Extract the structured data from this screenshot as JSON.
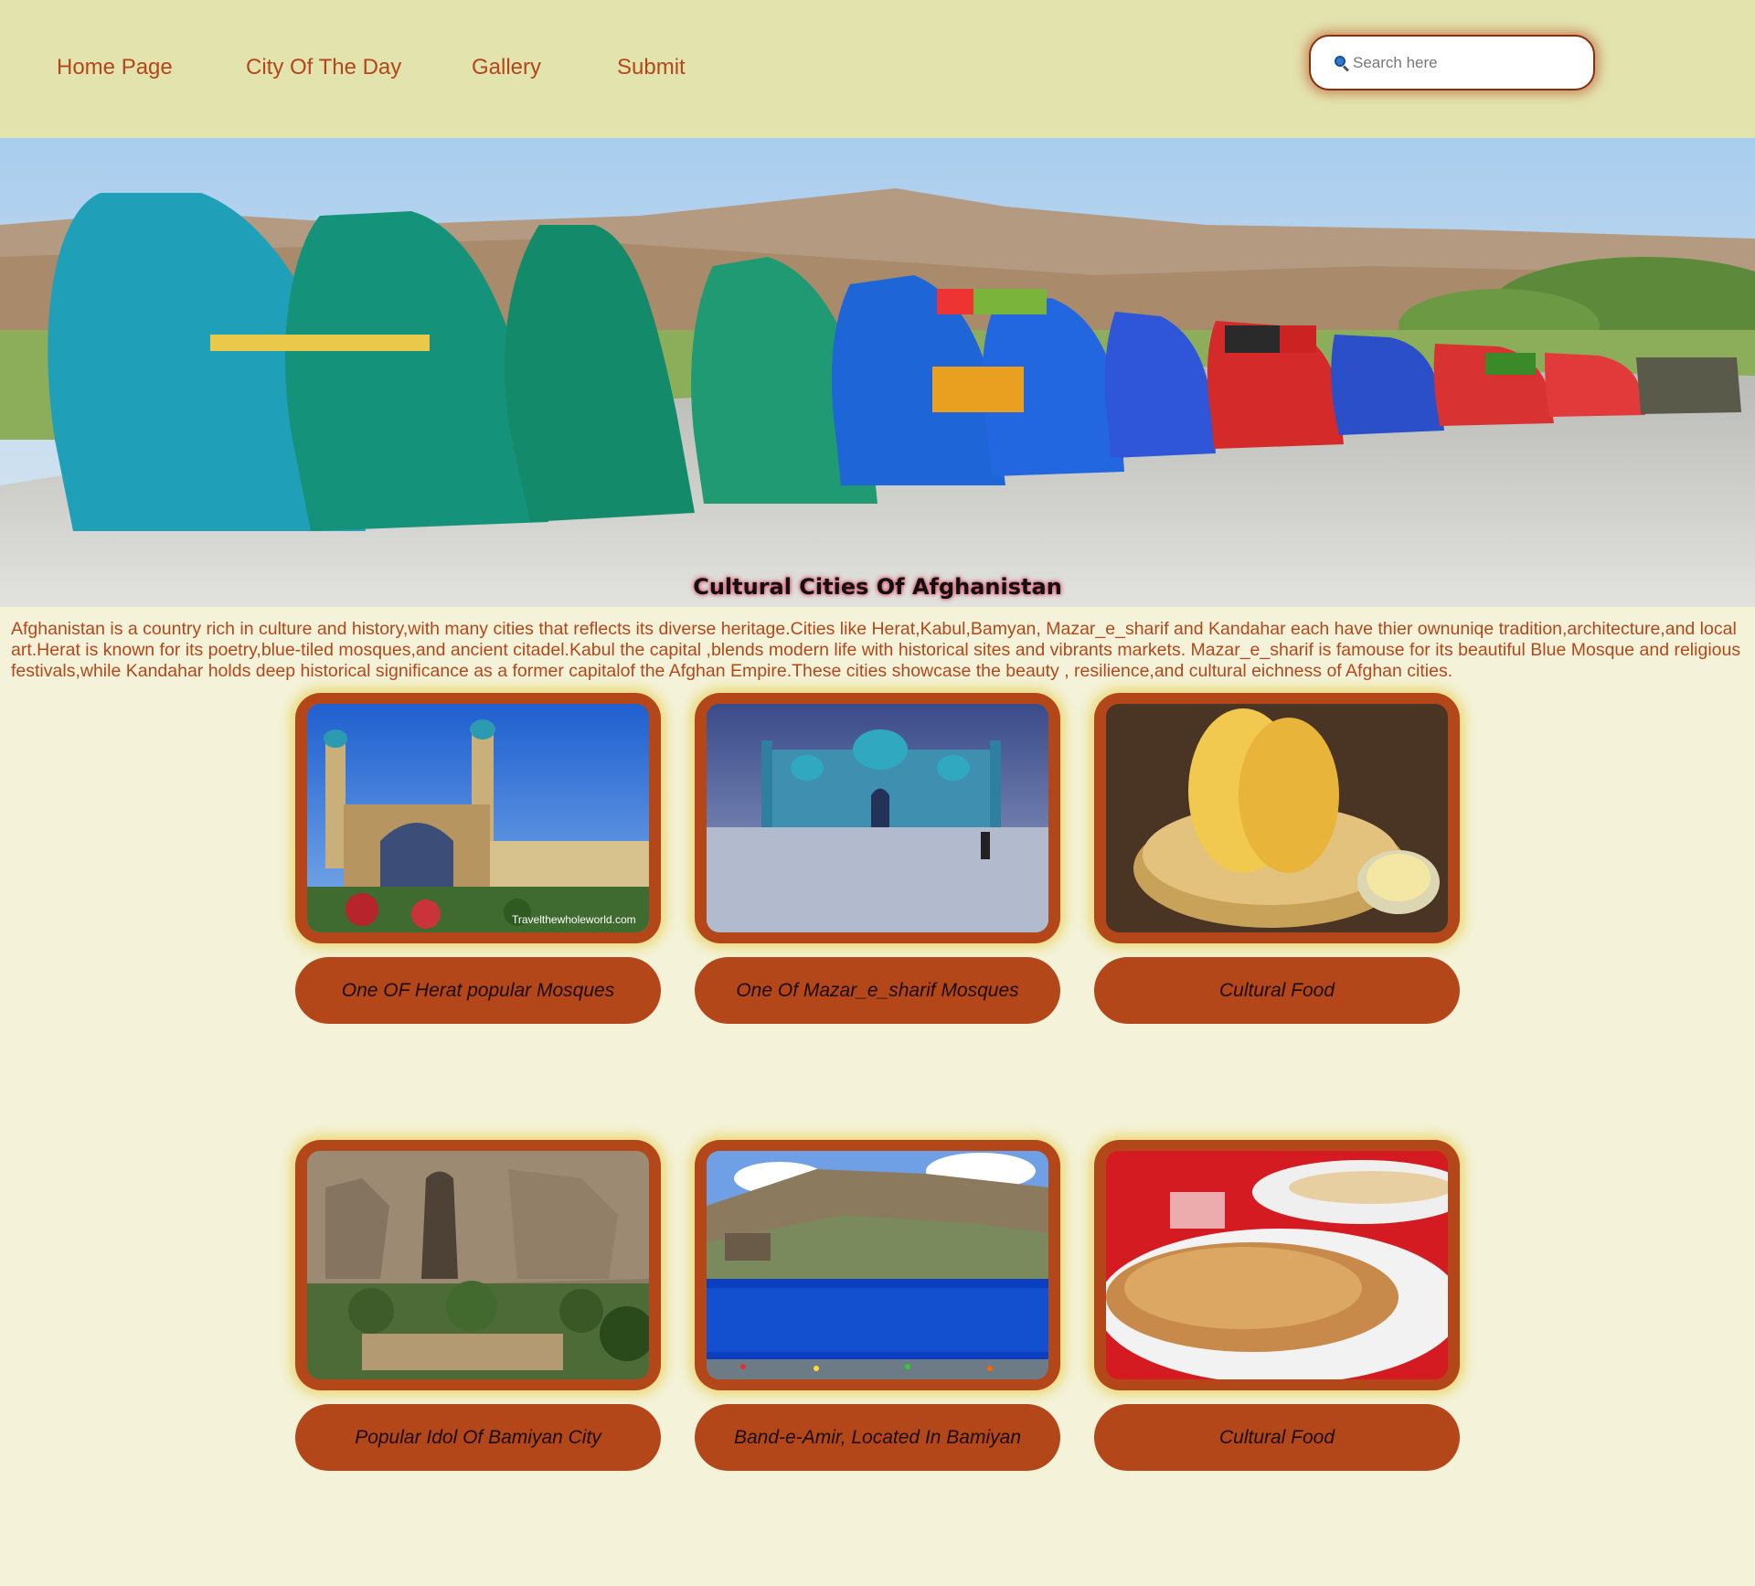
{
  "nav": {
    "items": [
      {
        "label": "Home Page"
      },
      {
        "label": "City Of The Day"
      },
      {
        "label": "Gallery"
      },
      {
        "label": "Submit"
      }
    ]
  },
  "search": {
    "placeholder": "Search here",
    "icon": "search-icon"
  },
  "hero": {
    "title": "Cultural Cities Of Afghanistan"
  },
  "intro": {
    "text": "Afghanistan is a country rich in culture and history,with many cities that reflects its diverse heritage.Cities like Herat,Kabul,Bamyan, Mazar_e_sharif and Kandahar each have thier ownuniqe tradition,architecture,and local art.Herat is known for its poetry,blue-tiled mosques,and ancient citadel.Kabul the capital ,blends modern life with historical sites and vibrants markets. Mazar_e_sharif is famouse for its beautiful Blue Mosque and religious festivals,while Kandahar holds deep historical significance as a former capitalof the Afghan Empire.These cities showcase the beauty , resilience,and cultural eichness of Afghan cities."
  },
  "gallery": {
    "cards": [
      {
        "caption": "One OF Herat popular Mosques",
        "watermark": "Travelthewholeworld.com"
      },
      {
        "caption": "One Of Mazar_e_sharif Mosques"
      },
      {
        "caption": "Cultural Food"
      },
      {
        "caption": "Popular Idol Of Bamiyan City"
      },
      {
        "caption": "Band-e-Amir, Located In Bamiyan"
      },
      {
        "caption": "Cultural Food"
      }
    ]
  },
  "colors": {
    "nav_background": "#e3e3ae",
    "page_background": "#f4f3da",
    "accent": "#b4471a"
  }
}
